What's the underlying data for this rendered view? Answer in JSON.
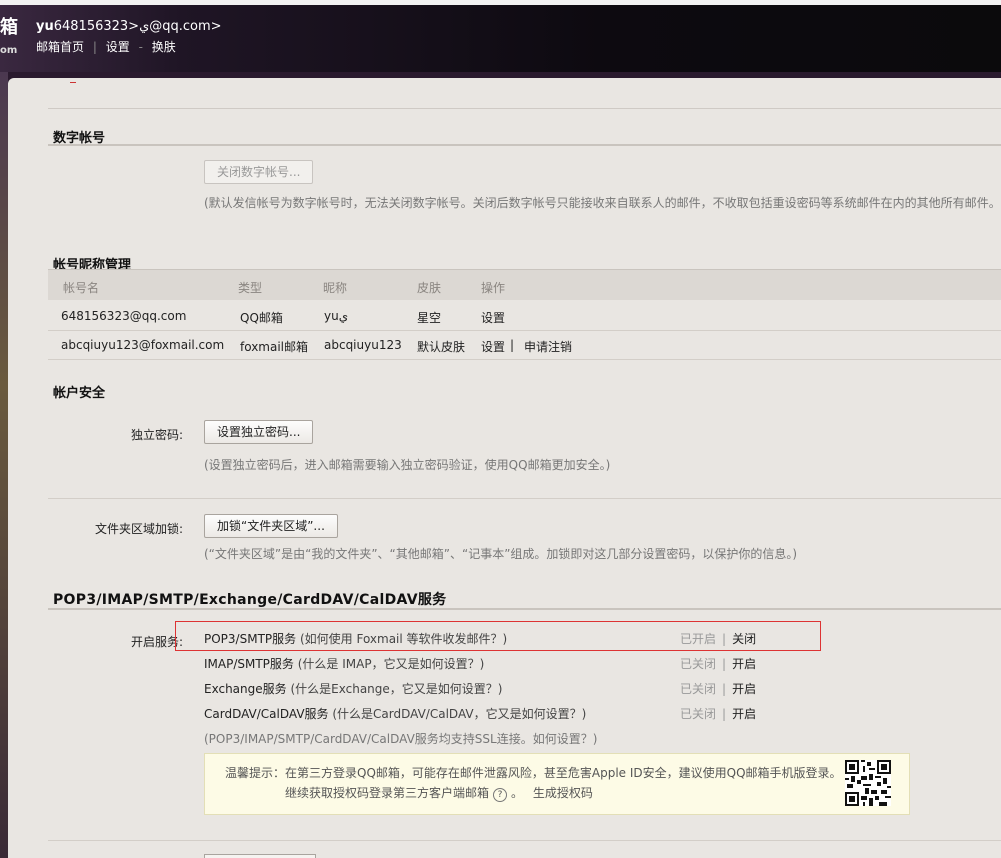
{
  "header": {
    "logo_char": "箱",
    "logo_sub": "om",
    "account_name": "yu",
    "account_email": "648156323>ي@qq.com>",
    "nav": [
      "邮箱首页",
      "设置",
      "换肤"
    ],
    "nav_sep": "|",
    "nav_sep2": "-"
  },
  "digital": {
    "title": "数字帐号",
    "button": "关闭数字帐号...",
    "note": "(默认发信帐号为数字帐号时，无法关闭数字帐号。关闭后数字帐号只能接收来自联系人的邮件，不收取包括重设密码等系统邮件在内的其他所有邮件。"
  },
  "nickname": {
    "title": "帐号昵称管理",
    "columns": [
      "帐号名",
      "类型",
      "昵称",
      "皮肤",
      "操作"
    ],
    "rows": [
      {
        "account": "648156323@qq.com",
        "type": "QQ邮箱",
        "nick": "yuي",
        "skin": "星空",
        "op1": "设置",
        "op_sep": "",
        "op2": ""
      },
      {
        "account": "abcqiuyu123@foxmail.com",
        "type": "foxmail邮箱",
        "nick": "abcqiuyu123",
        "skin": "默认皮肤",
        "op1": "设置",
        "op_sep": "|",
        "op2": "申请注销"
      }
    ]
  },
  "security": {
    "title": "帐户安全",
    "pwd_label": "独立密码:",
    "pwd_button": "设置独立密码...",
    "pwd_note": "(设置独立密码后，进入邮箱需要输入独立密码验证，使用QQ邮箱更加安全。)",
    "lock_label": "文件夹区域加锁:",
    "lock_button": "加锁“文件夹区域”...",
    "lock_note": "(“文件夹区域”是由“我的文件夹”、“其他邮箱”、“记事本”组成。加锁即对这几部分设置密码，以保护你的信息。)"
  },
  "services": {
    "title": "POP3/IMAP/SMTP/Exchange/CardDAV/CalDAV服务",
    "label": "开启服务:",
    "items": [
      {
        "name": "POP3/SMTP服务",
        "help": "(如何使用 Foxmail 等软件收发邮件？)",
        "status": "已开启",
        "action": "关闭"
      },
      {
        "name": "IMAP/SMTP服务",
        "help": "(什么是 IMAP，它又是如何设置？)",
        "status": "已关闭",
        "action": "开启"
      },
      {
        "name": "Exchange服务",
        "help": "(什么是Exchange，它又是如何设置？)",
        "status": "已关闭",
        "action": "开启"
      },
      {
        "name": "CardDAV/CalDAV服务",
        "help": "(什么是CardDAV/CalDAV，它又是如何设置？)",
        "status": "已关闭",
        "action": "开启"
      }
    ],
    "status_sep": "|",
    "ssl_note": "(POP3/IMAP/SMTP/CardDAV/CalDAV服务均支持SSL连接。如何设置？)",
    "tip_line1": "温馨提示：在第三方登录QQ邮箱，可能存在邮件泄露风险，甚至危害Apple ID安全，建议使用QQ邮箱手机版登录。",
    "tip_line2a": "继续获取授权码登录第三方客户端邮箱",
    "tip_qmark": "?",
    "tip_line2b": "。",
    "tip_link": "生成授权码"
  },
  "colors": {
    "panel_bg": "#e9e6e2",
    "highlight_border": "#dd3333",
    "tip_bg": "#fdfbe6"
  }
}
